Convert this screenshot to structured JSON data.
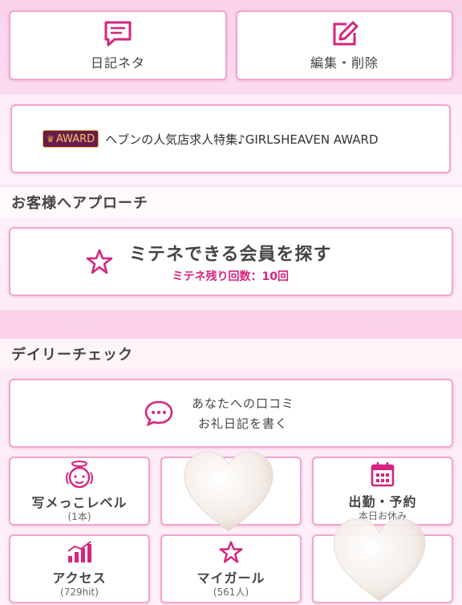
{
  "top_buttons": {
    "diary_neta": {
      "label": "日記ネタ",
      "icon": "memo-icon"
    },
    "edit_delete": {
      "label": "編集・削除",
      "icon": "edit-icon"
    }
  },
  "award_banner": {
    "badge": "AWARD",
    "text": "ヘブンの人気店求人特集♪GIRLSHEAVEN AWARD"
  },
  "approach_section": {
    "title": "お客様へアプローチ",
    "search_button": {
      "label": "ミテネできる会員を探す",
      "remaining": "ミテネ残り回数：10回",
      "icon": "star-icon"
    }
  },
  "daily_section": {
    "title": "デイリーチェック",
    "review_button": {
      "line1": "あなたへの口コミ",
      "line2": "お礼日記を書く",
      "icon": "chat-bubble-icon"
    },
    "tiles": [
      {
        "label": "写メっこレベル",
        "sub": "(1本)",
        "icon": "angel-face-icon"
      },
      {
        "label": "",
        "sub": "",
        "icon": ""
      },
      {
        "label": "出勤・予約",
        "sub": "本日お休み",
        "icon": "calendar-icon"
      },
      {
        "label": "アクセス",
        "sub": "(729hit)",
        "icon": "bar-chart-icon"
      },
      {
        "label": "マイガール",
        "sub": "(561人)",
        "icon": "star-icon"
      },
      {
        "label": "",
        "sub": "",
        "icon": ""
      }
    ]
  },
  "colors": {
    "accent": "#d6247e",
    "border": "#f0a6cf",
    "badge_bg": "#6a1b4d",
    "badge_gold": "#e8b33a"
  }
}
